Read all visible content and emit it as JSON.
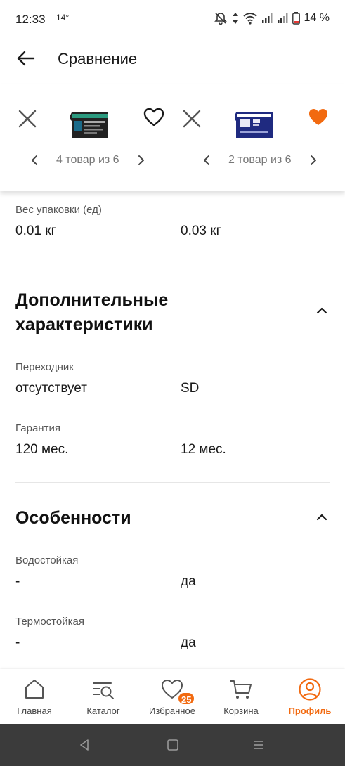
{
  "status_bar": {
    "time": "12:33",
    "temperature": "14°",
    "battery_percent": "14 %",
    "icons": [
      "bell-off-icon",
      "data-arrows-icon",
      "wifi-icon",
      "signal-icon",
      "signal-icon",
      "battery-icon"
    ]
  },
  "header": {
    "title": "Сравнение"
  },
  "compare": {
    "left": {
      "pager_text": "4 товар из 6",
      "favorite": false,
      "image": "microsd-card-kingston-256gb"
    },
    "right": {
      "pager_text": "2 товар из 6",
      "favorite": true,
      "image": "microsd-card-samsung-256gb"
    }
  },
  "specs": {
    "weight": {
      "label": "Вес упаковки (ед)",
      "left": "0.01 кг",
      "right": "0.03 кг"
    },
    "extra_section": {
      "title_line1": "Дополнительные",
      "title_line2": "характеристики",
      "adapter": {
        "label": "Переходник",
        "left": "отсутствует",
        "right": "SD"
      },
      "warranty": {
        "label": "Гарантия",
        "left": "120 мес.",
        "right": "12 мес."
      }
    },
    "features_section": {
      "title": "Особенности",
      "waterproof": {
        "label": "Водостойкая",
        "left": "-",
        "right": "да"
      },
      "heatproof": {
        "label": "Термостойкая",
        "left": "-",
        "right": "да"
      }
    }
  },
  "bottom_nav": {
    "items": [
      {
        "label": "Главная",
        "icon": "home-icon"
      },
      {
        "label": "Каталог",
        "icon": "catalog-search-icon"
      },
      {
        "label": "Избранное",
        "icon": "heart-icon",
        "badge": "25"
      },
      {
        "label": "Корзина",
        "icon": "cart-icon"
      },
      {
        "label": "Профиль",
        "icon": "profile-icon",
        "active": true
      }
    ]
  },
  "colors": {
    "accent": "#f26a10",
    "system_nav": "#3b3b3b"
  }
}
